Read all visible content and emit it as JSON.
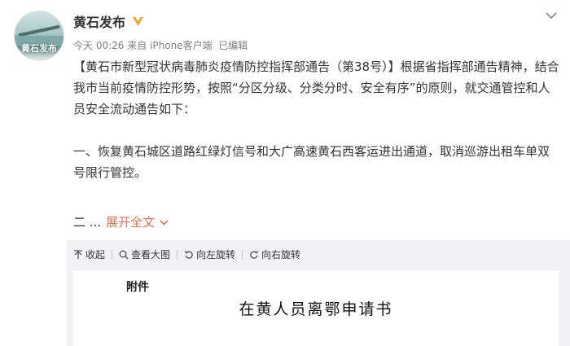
{
  "profile": {
    "avatar_text": "黄石发布",
    "name": "黄石发布",
    "verified_color": "#f2a81d"
  },
  "meta": {
    "date": "今天 00:26",
    "source_prefix": "来自",
    "client": "iPhone客户端",
    "edited": "已编辑"
  },
  "post": {
    "paragraph1": "【黄石市新型冠状病毒肺炎疫情防控指挥部通告（第38号）】根据省指挥部通告精神，结合我市当前疫情防控形势，按照“分区分级、分类分时、安全有序”的原则，就交通管控和人员安全流动通告如下：",
    "paragraph2": "一、恢复黄石城区道路红绿灯信号和大广高速黄石西客运进出通道，取消巡游出租车单双号限行管控。",
    "teaser": "二 ...",
    "expand_label": "展开全文"
  },
  "toolbar": {
    "collapse": "收起",
    "view_large": "查看大图",
    "rotate_left": "向左旋转",
    "rotate_right": "向右旋转"
  },
  "document": {
    "attachment_label": "附件",
    "title": "在黄人员离鄂申请书"
  },
  "colors": {
    "accent": "#eb7350",
    "text": "#333333",
    "muted": "#808080",
    "panel": "#f2f2f5"
  },
  "icons": [
    "verified-icon",
    "chevron-down-icon",
    "collapse-icon",
    "zoom-icon",
    "rotate-left-icon",
    "rotate-right-icon"
  ]
}
